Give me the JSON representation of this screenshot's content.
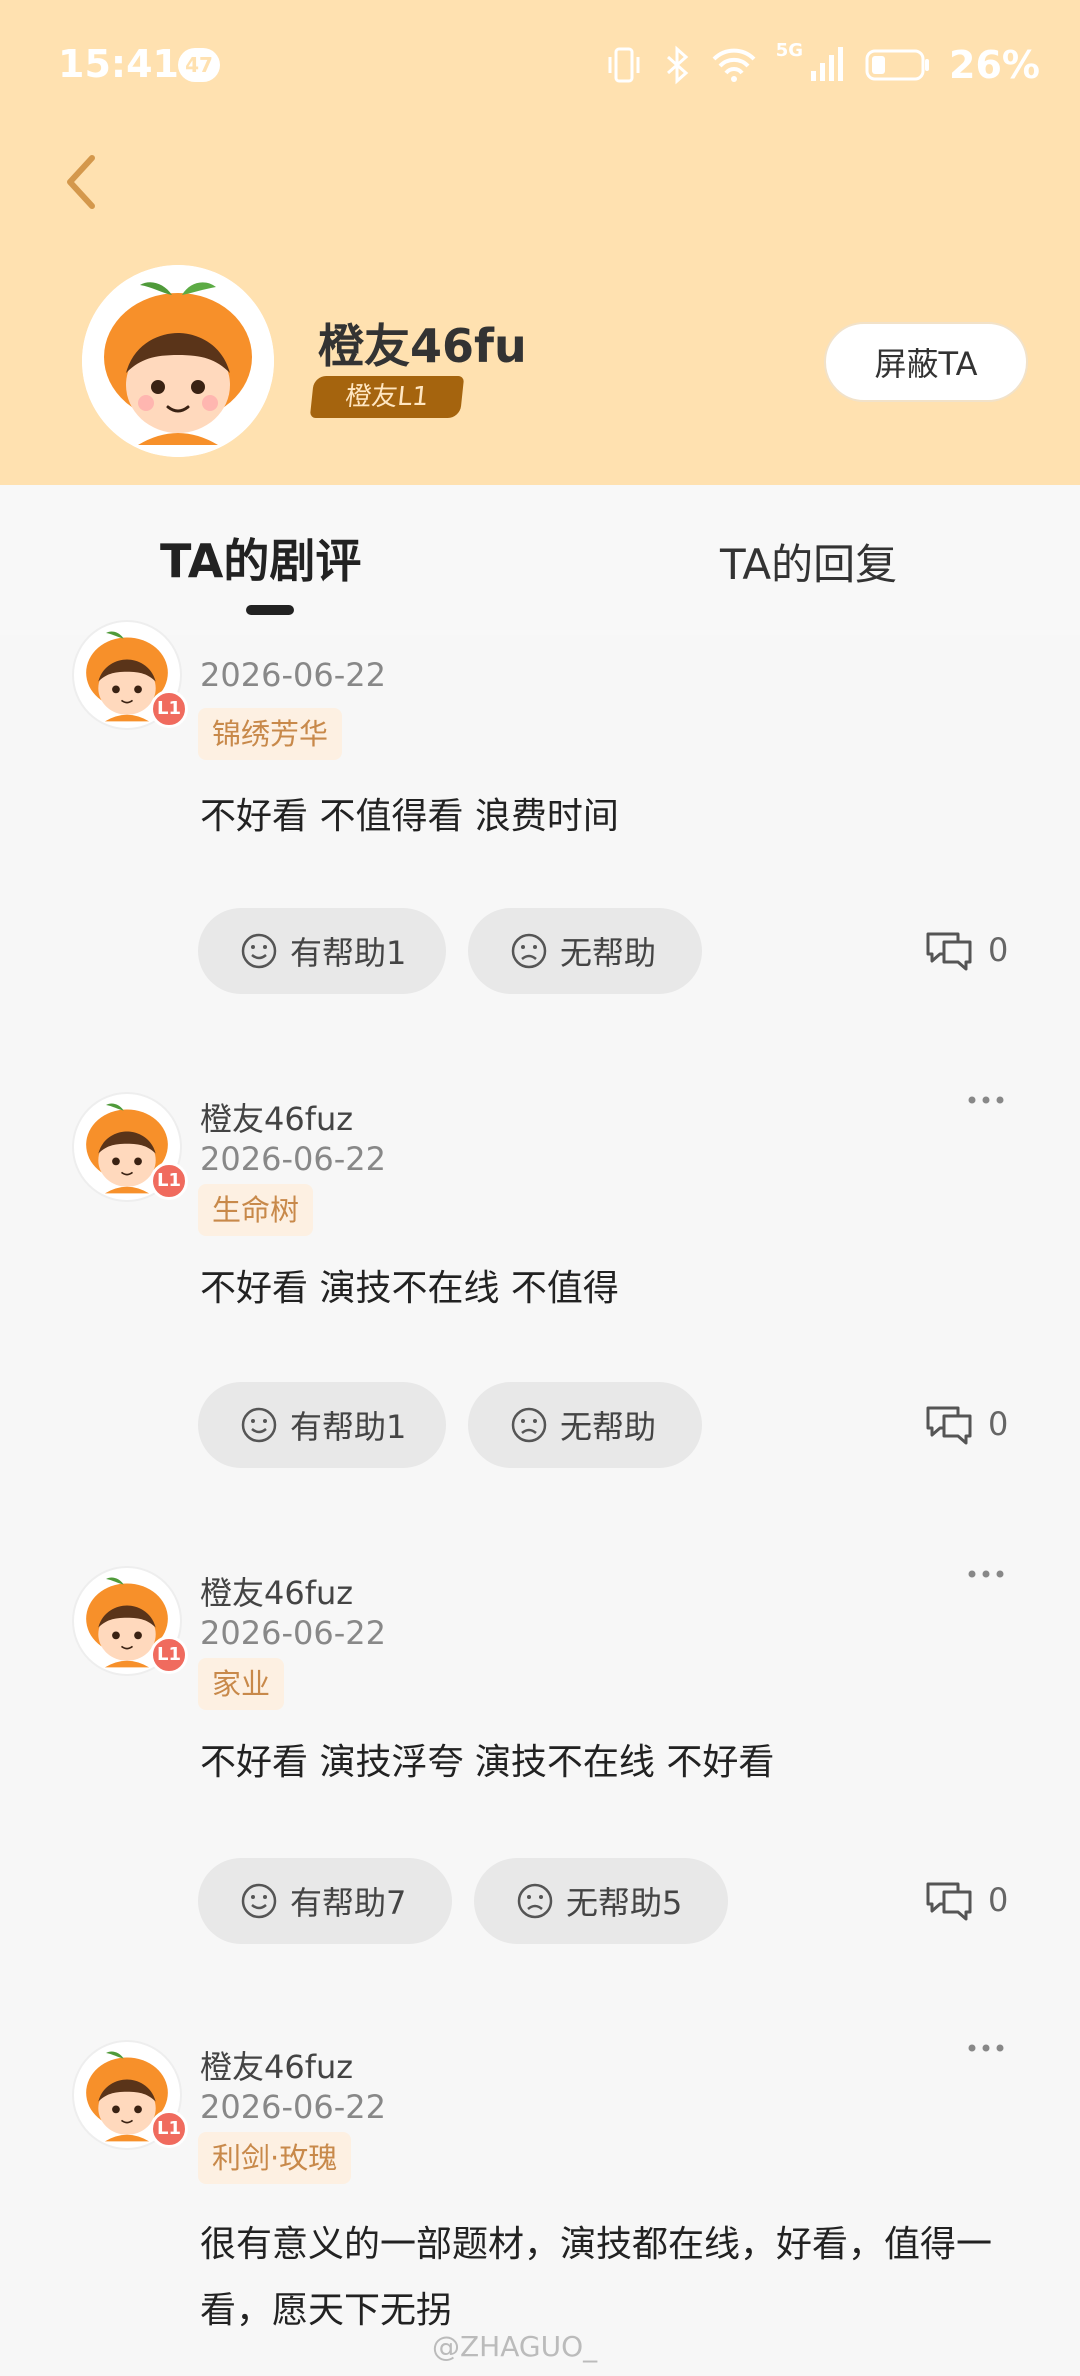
{
  "status_bar": {
    "time": "15:41",
    "badge": "47",
    "signal": "5G",
    "battery": "26%"
  },
  "profile": {
    "username": "橙友46fu",
    "level": "橙友L1",
    "block_button": "屏蔽TA"
  },
  "tabs": [
    {
      "label": "TA的剧评"
    },
    {
      "label": "TA的回复"
    }
  ],
  "reviews": [
    {
      "name": "",
      "level": "L1",
      "date": "2026-06-22",
      "tag": "锦绣芳华",
      "text": "不好看 不值得看 浪费时间",
      "helpful": "有帮助1",
      "unhelpful": "无帮助",
      "comments": "0"
    },
    {
      "name": "橙友46fuz",
      "level": "L1",
      "date": "2026-06-22",
      "tag": "生命树",
      "text": "不好看 演技不在线 不值得",
      "helpful": "有帮助1",
      "unhelpful": "无帮助",
      "comments": "0"
    },
    {
      "name": "橙友46fuz",
      "level": "L1",
      "date": "2026-06-22",
      "tag": "家业",
      "text": "不好看 演技浮夸 演技不在线 不好看",
      "helpful": "有帮助7",
      "unhelpful": "无帮助5",
      "comments": "0"
    },
    {
      "name": "橙友46fuz",
      "level": "L1",
      "date": "2026-06-22",
      "tag": "利剑·玫瑰",
      "text": "很有意义的一部题材，演技都在线，好看，值得一看，愿天下无拐",
      "helpful": "",
      "unhelpful": "",
      "comments": ""
    }
  ],
  "watermark": "@ZHAGUO_",
  "colors": {
    "header_bg": "#ffe1b0",
    "accent": "#c8894a",
    "level_badge": "#f06b5e"
  }
}
